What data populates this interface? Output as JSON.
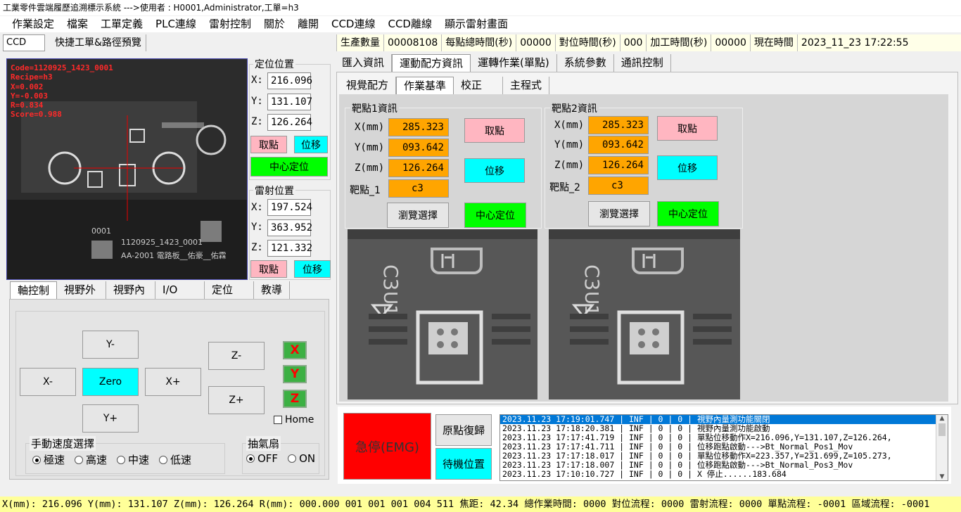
{
  "window": {
    "title": "工業零件雲端履歷追溯標示系統 --->使用者 : H0001,Administrator,工單=h3"
  },
  "menu": [
    "作業設定",
    "檔案",
    "工單定義",
    "PLC連線",
    "雷射控制",
    "關於",
    "離開",
    "CCD連線",
    "CCD離線",
    "顯示雷射畫面"
  ],
  "toolbar": {
    "ccd_select": "CCD",
    "preview_btn": "快捷工單&路徑預覽"
  },
  "status": {
    "prod_label": "生產數量",
    "prod_value": "00008108",
    "per_point_label": "每點總時間(秒)",
    "per_point_value": "00000",
    "align_label": "對位時間(秒)",
    "align_value": "000",
    "proc_label": "加工時間(秒)",
    "proc_value": "00000",
    "now_label": "現在時間",
    "now_value": "2023_11_23  17:22:55"
  },
  "camera": {
    "overlay": [
      "Code=1120925_1423_0001",
      "Recipe=h3",
      "X=0.002",
      "Y=-0.003",
      "R=0.834",
      "Score=0.988"
    ],
    "board_text1": "0001",
    "board_text2": "1120925_1423_0001",
    "board_text3": "AA-2001  電路板__佑豪__佑霖"
  },
  "position": {
    "title": "定位位置",
    "x_label": "X:",
    "x": "216.096",
    "y_label": "Y:",
    "y": "131.107",
    "z_label": "Z:",
    "z": "126.264",
    "take_btn": "取點",
    "move_btn": "位移",
    "center_btn": "中心定位"
  },
  "laser_pos": {
    "title": "雷射位置",
    "x_label": "X:",
    "x": "197.524",
    "y_label": "Y:",
    "y": "363.952",
    "z_label": "Z:",
    "z": "121.332",
    "take_btn": "取點",
    "move_btn": "位移"
  },
  "left_tabs": [
    "軸控制",
    "視野外",
    "視野內",
    "I/O",
    "定位",
    "教導"
  ],
  "axis": {
    "y_minus": "Y-",
    "x_minus": "X-",
    "zero": "Zero",
    "x_plus": "X+",
    "y_plus": "Y+",
    "z_minus": "Z-",
    "z_plus": "Z+",
    "x_ind": "X",
    "y_ind": "Y",
    "z_ind": "Z",
    "home": "Home",
    "speed_title": "手動速度選擇",
    "speeds": [
      "極速",
      "高速",
      "中速",
      "低速"
    ],
    "fan_title": "抽氣扇",
    "fan_off": "OFF",
    "fan_on": "ON"
  },
  "main_tabs": [
    "匯入資訊",
    "運動配方資訊",
    "運轉作業(單點)",
    "系統參數",
    "通訊控制"
  ],
  "sub_tabs": [
    "視覺配方",
    "作業基準",
    "校正",
    "主程式"
  ],
  "target1": {
    "title": "靶點1資訊",
    "x_label": "X(mm)",
    "x": "285.323",
    "y_label": "Y(mm)",
    "y": "093.642",
    "z_label": "Z(mm)",
    "z": "126.264",
    "t_label": "靶點_1",
    "t": "c3",
    "take_btn": "取點",
    "move_btn": "位移",
    "browse_btn": "瀏覽選擇",
    "center_btn": "中心定位"
  },
  "target2": {
    "title": "靶點2資訊",
    "x_label": "X(mm)",
    "x": "285.323",
    "y_label": "Y(mm)",
    "y": "093.642",
    "z_label": "Z(mm)",
    "z": "126.264",
    "t_label": "靶點_2",
    "t": "c3",
    "take_btn": "取點",
    "move_btn": "位移",
    "browse_btn": "瀏覽選擇",
    "center_btn": "中心定位"
  },
  "pcb_text": {
    "c3": "C3",
    "u1": "U1"
  },
  "controls": {
    "emg": "急停(EMG)",
    "home_return": "原點復歸",
    "standby": "待機位置"
  },
  "log": [
    "2023.11.23 17:19:01.747 | INF | 0 | 0 | 視野內量測功能關閉",
    "2023.11.23 17:18:20.381 | INF | 0 | 0 | 視野內量測功能啟動",
    "2023.11.23 17:17:41.719 | INF | 0 | 0 | 單點位移動作X=216.096,Y=131.107,Z=126.264,",
    "2023.11.23 17:17:41.711 | INF | 0 | 0 | 位移跑點啟動--->Bt_Normal_Pos1_Mov",
    "2023.11.23 17:17:18.017 | INF | 0 | 0 | 單點位移動作X=223.357,Y=231.699,Z=105.273,",
    "2023.11.23 17:17:18.007 | INF | 0 | 0 | 位移跑點啟動--->Bt_Normal_Pos3_Mov",
    "2023.11.23 17:10:10.727 | INF | 0 | 0 | X  停止......183.684"
  ],
  "bottom_status": "X(mm): 216.096 Y(mm): 131.107 Z(mm): 126.264 R(mm): 000.000 001 001 001 004 511 焦距: 42.34 總作業時間: 0000 對位流程: 0000 雷射流程: 0000 單點流程: -0001 區域流程: -0001"
}
